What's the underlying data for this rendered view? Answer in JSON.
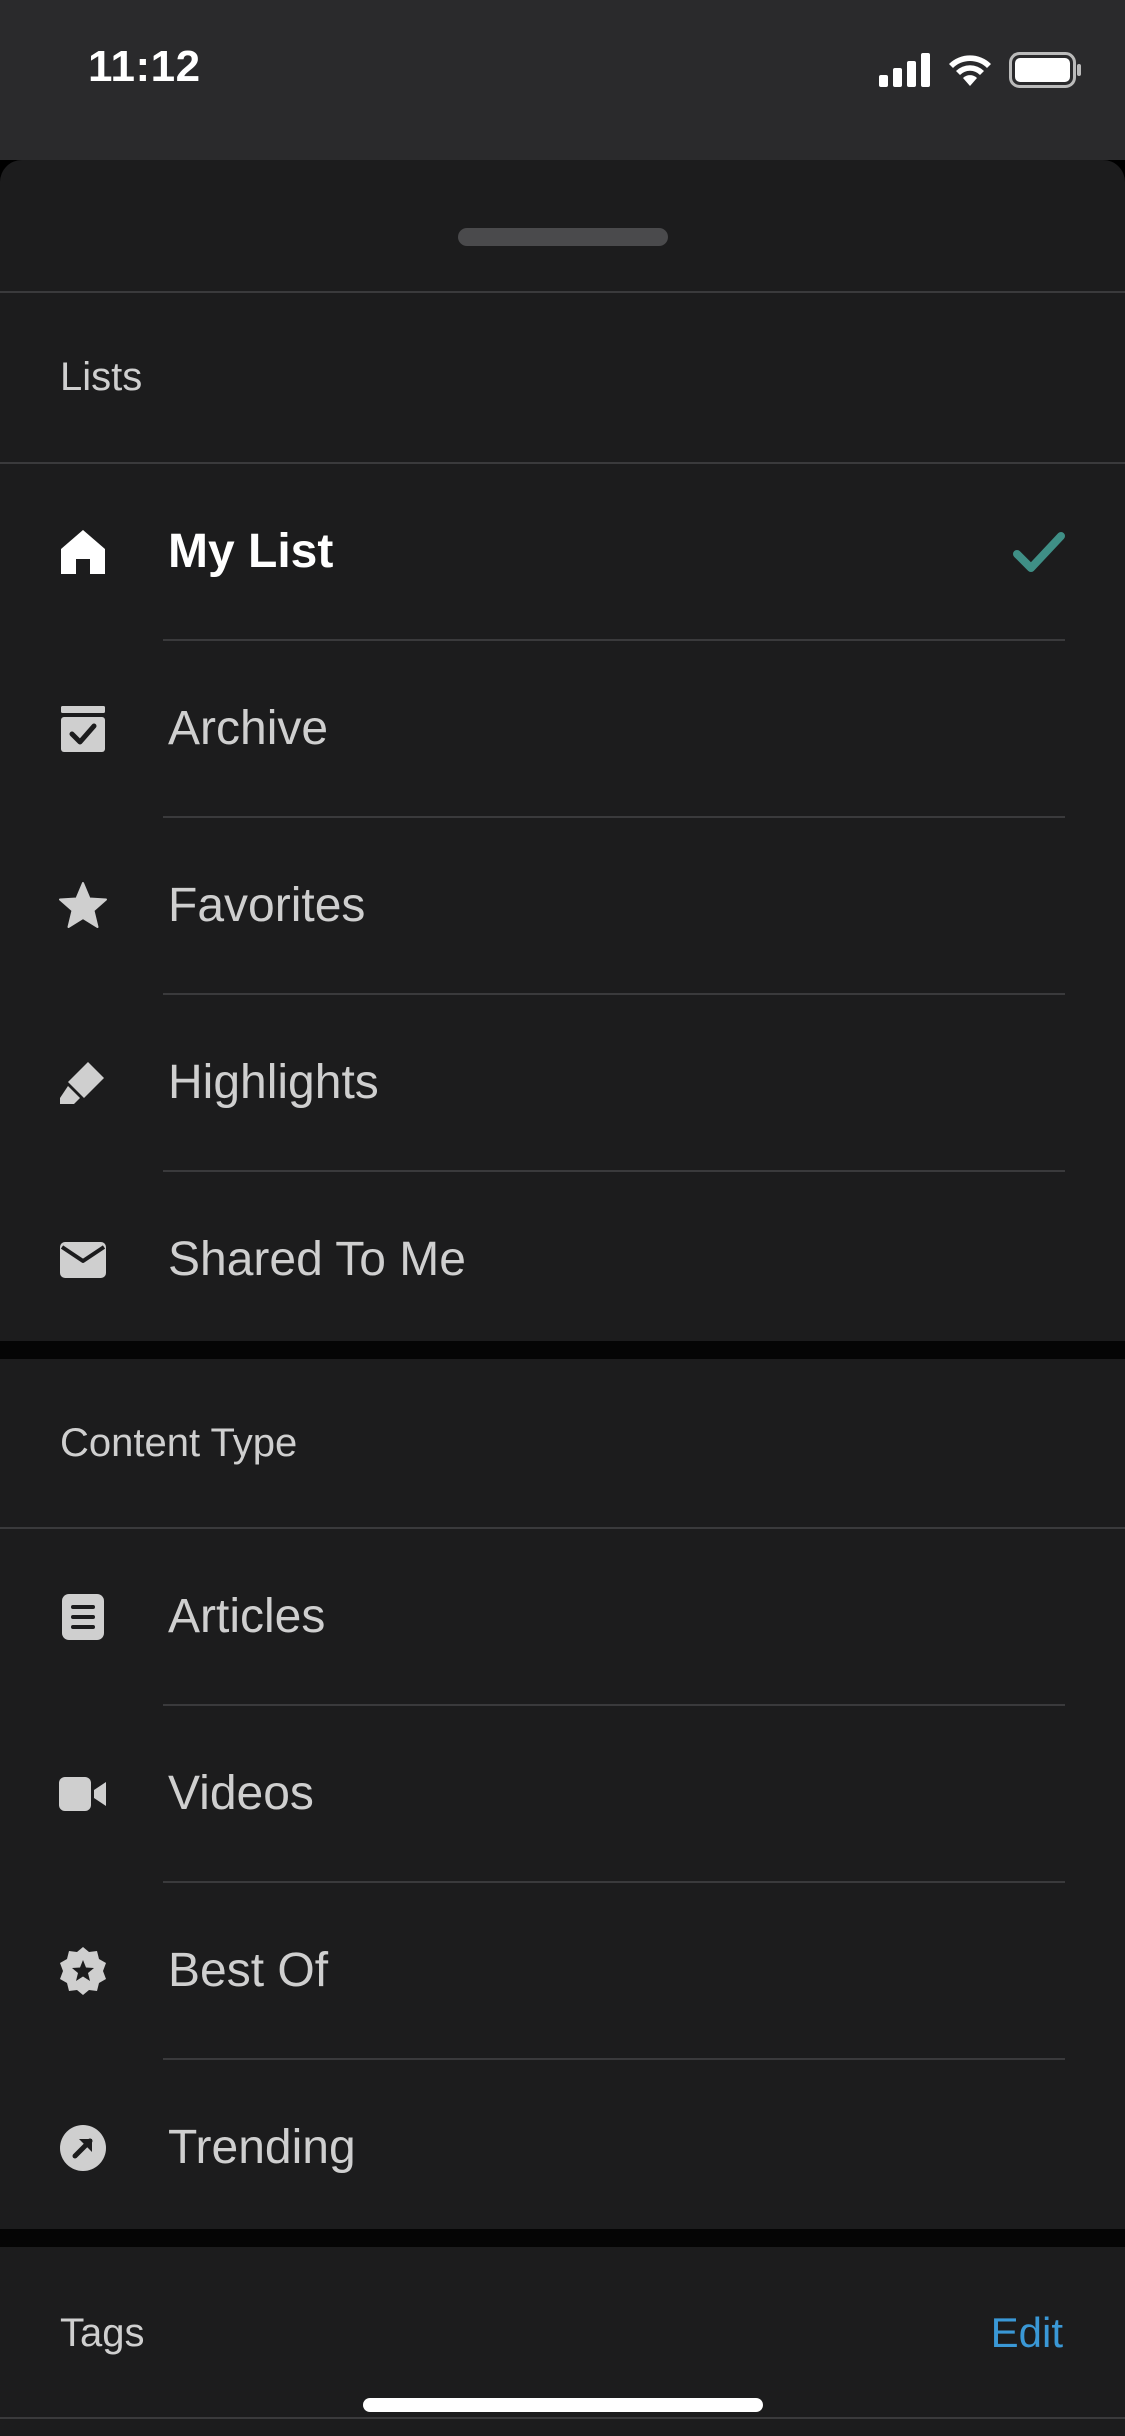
{
  "status_bar": {
    "time": "11:12"
  },
  "lists": {
    "header": "Lists",
    "items": [
      {
        "label": "My List",
        "icon": "home-icon",
        "selected": true
      },
      {
        "label": "Archive",
        "icon": "archive-icon"
      },
      {
        "label": "Favorites",
        "icon": "star-icon"
      },
      {
        "label": "Highlights",
        "icon": "highlighter-icon"
      },
      {
        "label": "Shared To Me",
        "icon": "envelope-icon"
      }
    ]
  },
  "content_type": {
    "header": "Content Type",
    "items": [
      {
        "label": "Articles",
        "icon": "document-icon"
      },
      {
        "label": "Videos",
        "icon": "video-camera-icon"
      },
      {
        "label": "Best Of",
        "icon": "badge-star-icon"
      },
      {
        "label": "Trending",
        "icon": "trending-arrow-icon"
      }
    ]
  },
  "tags": {
    "header": "Tags",
    "edit_label": "Edit"
  },
  "colors": {
    "accent_check": "#3f8f86",
    "link": "#3a98d6",
    "sheet_bg": "#1c1c1d"
  }
}
